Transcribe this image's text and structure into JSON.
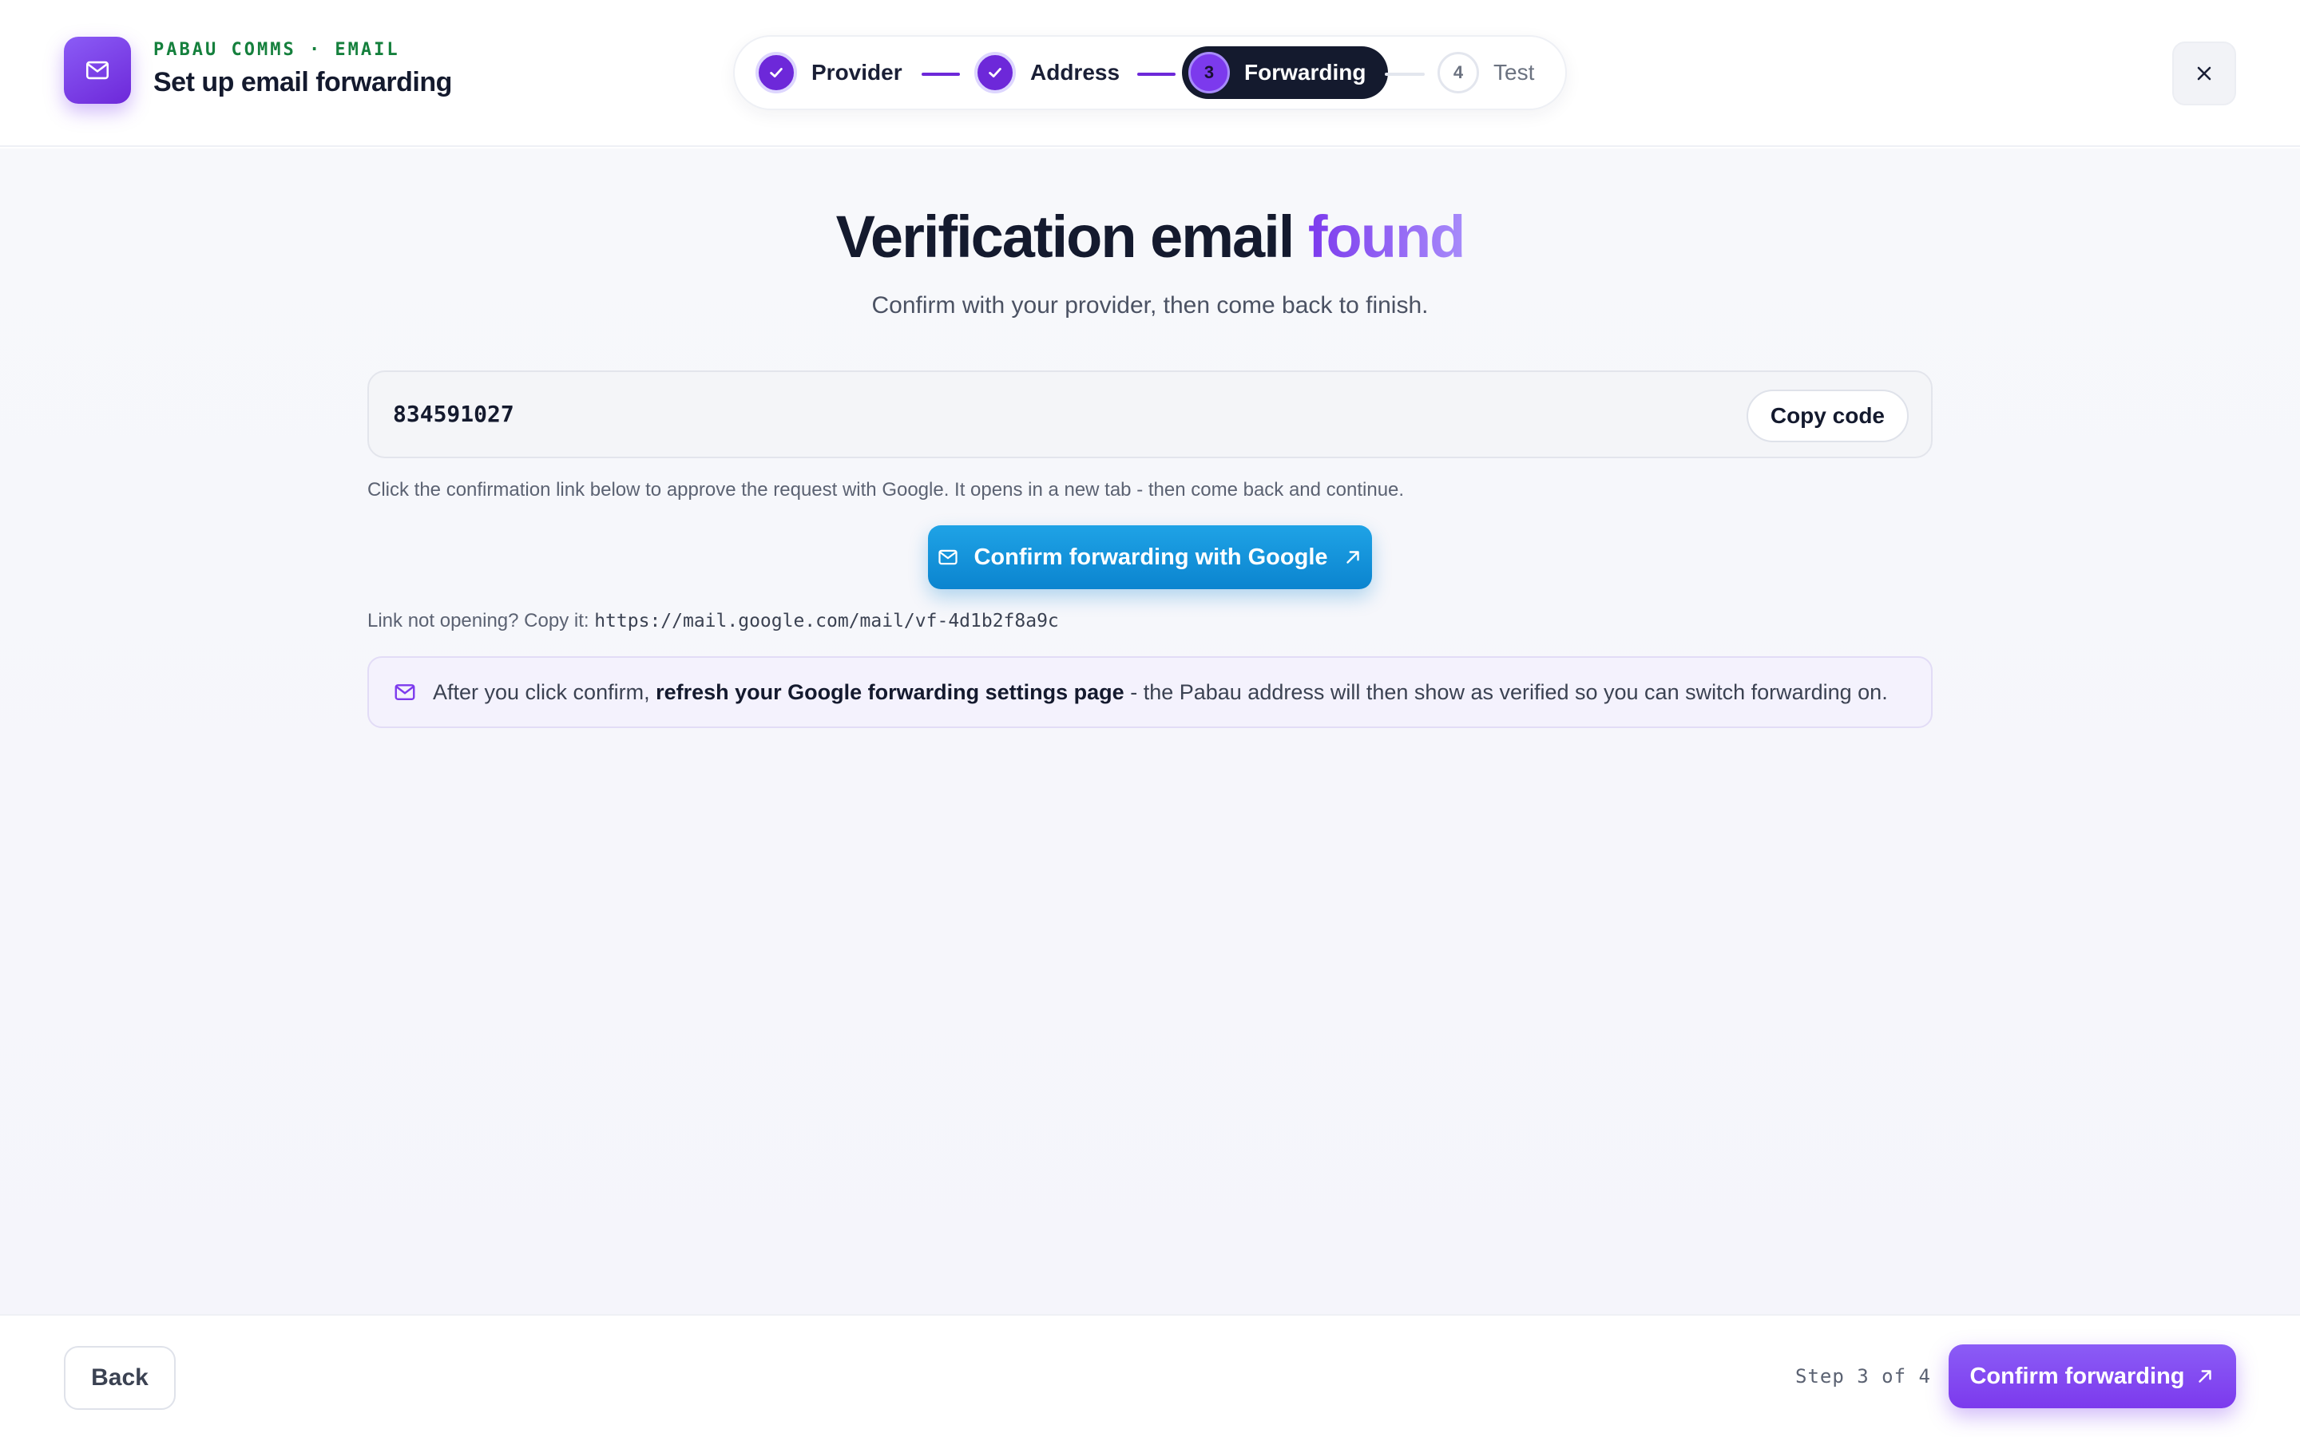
{
  "header": {
    "eyebrow": "PABAU COMMS · EMAIL",
    "title": "Set up email forwarding",
    "brand_icon": "mail-icon",
    "close_icon": "close-icon"
  },
  "stepper": {
    "steps": [
      {
        "number": "1",
        "label": "Provider",
        "state": "done"
      },
      {
        "number": "2",
        "label": "Address",
        "state": "done"
      },
      {
        "number": "3",
        "label": "Forwarding",
        "state": "active"
      },
      {
        "number": "4",
        "label": "Test",
        "state": "pending"
      }
    ]
  },
  "main": {
    "headline_main": "Verification email",
    "headline_accent": "found",
    "subhead": "Confirm with your provider, then come back to finish.",
    "code": "834591027",
    "copy_label": "Copy code",
    "hint": "Click the confirmation link below to approve the request with Google. It opens in a new tab - then come back and continue.",
    "google_button": "Confirm forwarding with Google",
    "fallback_prefix": "Link not opening? Copy it:",
    "fallback_url": "https://mail.google.com/mail/vf-4d1b2f8a9c",
    "notice_before": "After you click confirm,",
    "notice_bold": "refresh your Google forwarding settings page",
    "notice_after": "- the Pabau address will then show as verified so you can switch forwarding on."
  },
  "footer": {
    "back_label": "Back",
    "step_count": "Step 3 of 4",
    "primary_label": "Confirm forwarding"
  },
  "colors": {
    "accent": "#7c3aed",
    "dark": "#141a2e",
    "google_blue": "#0b84cf",
    "eyebrow_green": "#15803d"
  }
}
